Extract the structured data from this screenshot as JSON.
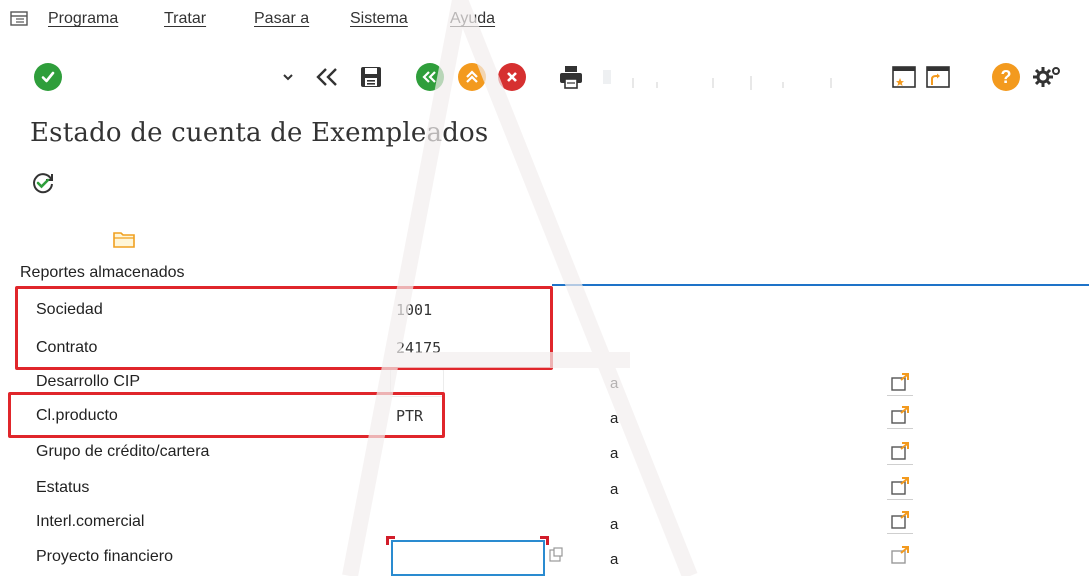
{
  "menu": {
    "items": [
      "Programa",
      "Tratar",
      "Pasar a",
      "Sistema",
      "Ayuda"
    ]
  },
  "toolbar": {
    "icons": [
      "checkmark-icon",
      "dropdown-icon",
      "back-arrows-icon",
      "save-icon",
      "back-icon",
      "exit-icon",
      "cancel-icon",
      "print-icon",
      "find-icon",
      "first-page-icon",
      "prev-page-icon",
      "next-page-icon",
      "last-page-icon",
      "new-session-icon",
      "shortcut-icon",
      "help-icon",
      "settings-icon"
    ]
  },
  "page": {
    "title": "Estado de cuenta de Exempleados",
    "reports_label": "Reportes almacenados"
  },
  "form": {
    "rows": [
      {
        "label": "Sociedad",
        "value": "1001",
        "to": ""
      },
      {
        "label": "Contrato",
        "value": "24175",
        "to": ""
      },
      {
        "label": "Desarrollo CIP",
        "value": "",
        "to": "a"
      },
      {
        "label": "Cl.producto",
        "value": "PTR",
        "to": "a"
      },
      {
        "label": "Grupo de crédito/cartera",
        "value": "",
        "to": "a"
      },
      {
        "label": "Estatus",
        "value": "",
        "to": "a"
      },
      {
        "label": "Interl.comercial",
        "value": "",
        "to": "a"
      },
      {
        "label": "Proyecto financiero",
        "value": "",
        "to": "a"
      }
    ]
  },
  "colors": {
    "accent_blue": "#1e73c8",
    "highlight_red": "#e0262b",
    "ok_green": "#2f9e3b",
    "exit_orange": "#f39a1e",
    "cancel_red": "#d63030"
  }
}
